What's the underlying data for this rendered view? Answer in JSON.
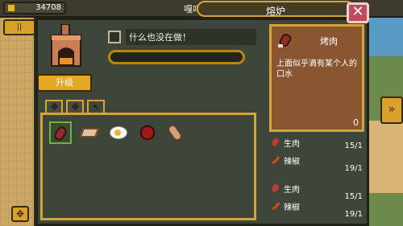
{
  "hud": {
    "coins": "34708",
    "npc_name": "嘎呜"
  },
  "window": {
    "title": "熔炉"
  },
  "furnace": {
    "upgrade_label": "升级",
    "status_text": "什么也没在做！",
    "progress": 0
  },
  "tabs": [
    {
      "icon": "diamond-icon"
    },
    {
      "icon": "diamond-icon"
    },
    {
      "icon": "cursor-icon"
    }
  ],
  "recipes": [
    {
      "name": "烤肉",
      "icon": "roast-meat-icon",
      "selected": true
    },
    {
      "name": "pie",
      "icon": "pie-icon",
      "selected": false
    },
    {
      "name": "egg",
      "icon": "fried-egg-icon",
      "selected": false
    },
    {
      "name": "berry",
      "icon": "berry-icon",
      "selected": false
    },
    {
      "name": "drumstick",
      "icon": "drumstick-icon",
      "selected": false
    }
  ],
  "detail": {
    "title": "烤肉",
    "description": "上面似乎滴有某个人的口水",
    "count": "0"
  },
  "ingredients": [
    {
      "name": "生肉",
      "count": "15/1"
    },
    {
      "name": "辣椒",
      "count": "19/1"
    },
    {
      "name": "生肉",
      "count": "15/1"
    },
    {
      "name": "辣椒",
      "count": "19/1"
    }
  ],
  "colors": {
    "accent": "#d2a43a",
    "panel": "#3e463a",
    "close": "#c04a57"
  }
}
